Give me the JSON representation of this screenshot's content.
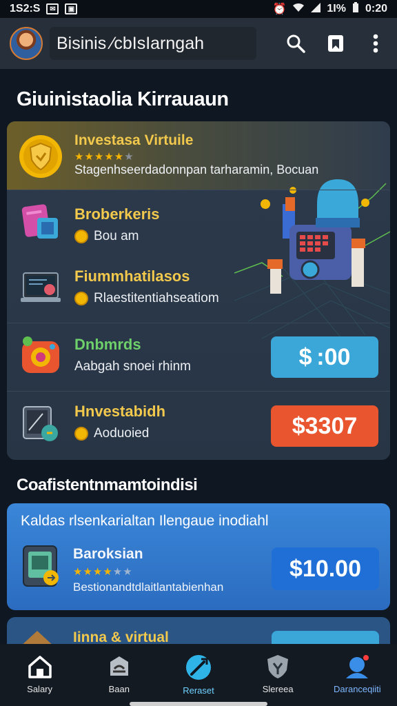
{
  "status_bar": {
    "time_left": "1S2:S",
    "battery": "1I%",
    "time_right": "0:20"
  },
  "app_bar": {
    "title": "Bisinis ⁄cbIsIarngah"
  },
  "section1": {
    "title": "Giuinistaolia Kirrauaun"
  },
  "items": [
    {
      "name": "Investasa Virtuile",
      "subtitle": "Stagenhseerdadonnpan tarharamin, Bocuan",
      "stars": 5
    },
    {
      "name": "Broberkeris",
      "subtitle": "Bou am"
    },
    {
      "name": "Fiummhatilasos",
      "subtitle": "Rlaestitentiahseatiom"
    },
    {
      "name": "Dnbmrds",
      "subtitle": "Aabgah snoei rhinm",
      "price": "$ :00"
    },
    {
      "name": "Hnvestabidh",
      "subtitle": "Aoduoied",
      "price": "$3307"
    }
  ],
  "section2": {
    "title": "Coafistentnmamtoindisi"
  },
  "promo": {
    "heading": "Kaldas rlsenkarialtan Ilengaue inodiahl",
    "item_name": "Baroksian",
    "stars": 4,
    "subtitle": "Bestionandtdlaitlantabienhan",
    "price": "$10.00"
  },
  "peek": {
    "name": "Iinna & virtual"
  },
  "nav": [
    {
      "label": "Salary",
      "icon": "home-icon"
    },
    {
      "label": "Baan",
      "icon": "briefcase-icon"
    },
    {
      "label": "Reraset",
      "icon": "rocket-icon"
    },
    {
      "label": "Slereea",
      "icon": "shield-icon"
    },
    {
      "label": "Daranceqiiti",
      "icon": "profile-icon"
    }
  ],
  "colors": {
    "accent_gold": "#f2c94c",
    "price_blue": "#3ba7d8",
    "price_orange": "#e8552f",
    "promo_blue": "#3a86d8"
  }
}
